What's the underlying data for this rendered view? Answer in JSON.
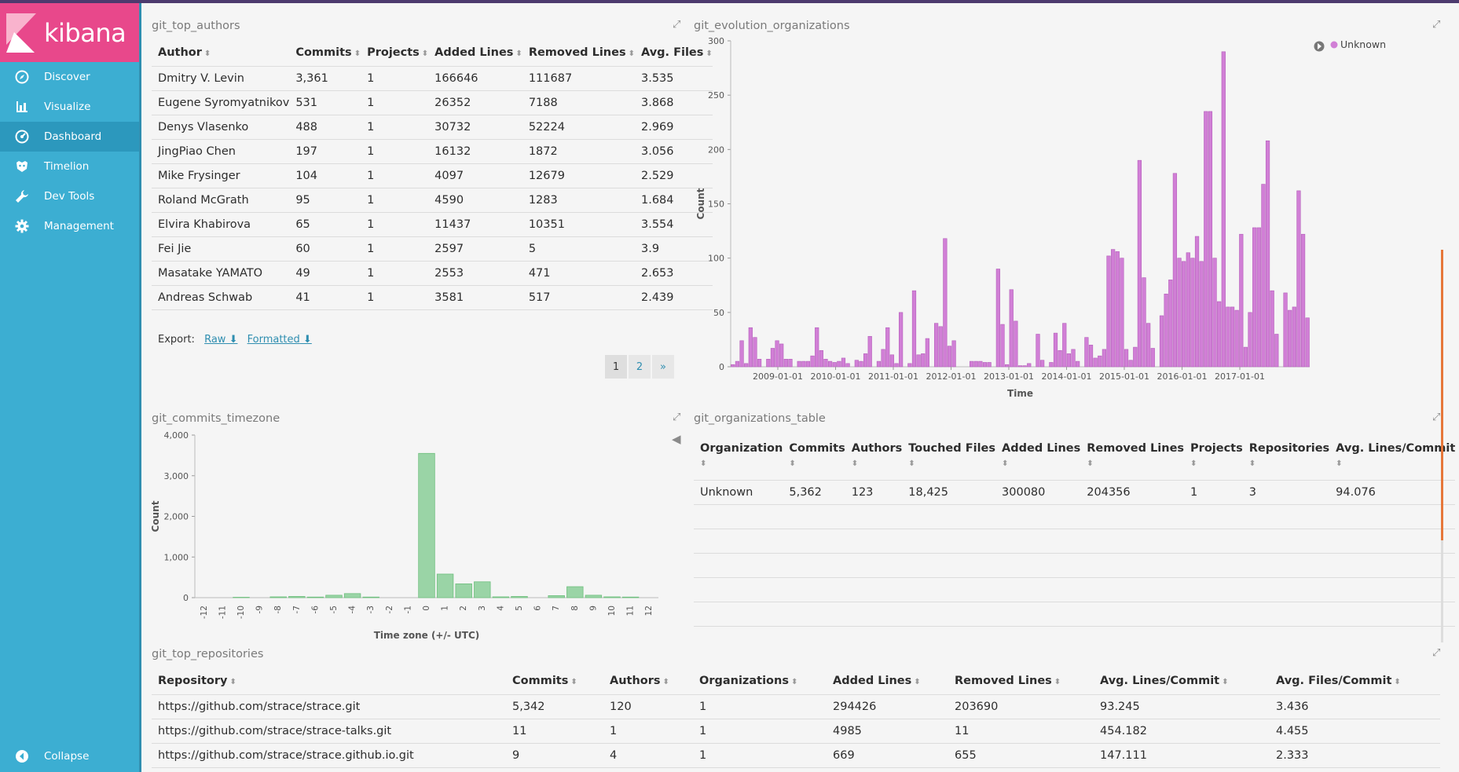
{
  "sidebar": {
    "brand": "kibana",
    "items": [
      {
        "label": "Discover",
        "icon": "compass-icon"
      },
      {
        "label": "Visualize",
        "icon": "bar-chart-icon"
      },
      {
        "label": "Dashboard",
        "icon": "dashboard-icon"
      },
      {
        "label": "Timelion",
        "icon": "timelion-icon"
      },
      {
        "label": "Dev Tools",
        "icon": "wrench-icon"
      },
      {
        "label": "Management",
        "icon": "gear-icon"
      }
    ],
    "active": "Dashboard",
    "collapse_label": "Collapse"
  },
  "top_authors": {
    "title": "git_top_authors",
    "headers": [
      "Author",
      "Commits",
      "Projects",
      "Added Lines",
      "Removed Lines",
      "Avg. Files"
    ],
    "rows": [
      [
        "Dmitry V. Levin",
        "3,361",
        "1",
        "166646",
        "111687",
        "3.535"
      ],
      [
        "Eugene Syromyatnikov",
        "531",
        "1",
        "26352",
        "7188",
        "3.868"
      ],
      [
        "Denys Vlasenko",
        "488",
        "1",
        "30732",
        "52224",
        "2.969"
      ],
      [
        "JingPiao Chen",
        "197",
        "1",
        "16132",
        "1872",
        "3.056"
      ],
      [
        "Mike Frysinger",
        "104",
        "1",
        "4097",
        "12679",
        "2.529"
      ],
      [
        "Roland McGrath",
        "95",
        "1",
        "4590",
        "1283",
        "1.684"
      ],
      [
        "Elvira Khabirova",
        "65",
        "1",
        "11437",
        "10351",
        "3.554"
      ],
      [
        "Fei Jie",
        "60",
        "1",
        "2597",
        "5",
        "3.9"
      ],
      [
        "Masatake YAMATO",
        "49",
        "1",
        "2553",
        "471",
        "2.653"
      ],
      [
        "Andreas Schwab",
        "41",
        "1",
        "3581",
        "517",
        "2.439"
      ]
    ],
    "export_label": "Export:",
    "export_raw": "Raw",
    "export_formatted": "Formatted",
    "pages": [
      "1",
      "2",
      "»"
    ]
  },
  "evolution": {
    "title": "git_evolution_organizations",
    "legend": "Unknown",
    "ylabel": "Count",
    "xlabel": "Time",
    "yticks": [
      "0",
      "50",
      "100",
      "150",
      "200",
      "250",
      "300"
    ],
    "xticks": [
      "2009-01-01",
      "2010-01-01",
      "2011-01-01",
      "2012-01-01",
      "2013-01-01",
      "2014-01-01",
      "2015-01-01",
      "2016-01-01",
      "2017-01-01"
    ],
    "color": "#d17fd6"
  },
  "timezone": {
    "title": "git_commits_timezone",
    "ylabel": "Count",
    "xlabel": "Time zone (+/- UTC)",
    "yticks": [
      "0",
      "1,000",
      "2,000",
      "3,000",
      "4,000"
    ],
    "color": "#9ad4a6"
  },
  "org_table": {
    "title": "git_organizations_table",
    "headers": [
      "Organization",
      "Commits",
      "Authors",
      "Touched Files",
      "Added Lines",
      "Removed Lines",
      "Projects",
      "Repositories",
      "Avg. Lines/Commit"
    ],
    "rows": [
      [
        "Unknown",
        "5,362",
        "123",
        "18,425",
        "300080",
        "204356",
        "1",
        "3",
        "94.076"
      ]
    ]
  },
  "top_repos": {
    "title": "git_top_repositories",
    "headers": [
      "Repository",
      "Commits",
      "Authors",
      "Organizations",
      "Added Lines",
      "Removed Lines",
      "Avg. Lines/Commit",
      "Avg. Files/Commit"
    ],
    "rows": [
      [
        "https://github.com/strace/strace.git",
        "5,342",
        "120",
        "1",
        "294426",
        "203690",
        "93.245",
        "3.436"
      ],
      [
        "https://github.com/strace/strace-talks.git",
        "11",
        "1",
        "1",
        "4985",
        "11",
        "454.182",
        "4.455"
      ],
      [
        "https://github.com/strace/strace.github.io.git",
        "9",
        "4",
        "1",
        "669",
        "655",
        "147.111",
        "2.333"
      ]
    ]
  },
  "chart_data": [
    {
      "type": "bar",
      "title": "git_evolution_organizations",
      "xlabel": "Time",
      "ylabel": "Count",
      "ylim": [
        0,
        300
      ],
      "series": [
        {
          "name": "Unknown",
          "values": [
            2,
            5,
            24,
            3,
            36,
            27,
            7,
            0,
            7,
            17,
            24,
            21,
            7,
            7,
            0,
            5,
            5,
            5,
            10,
            36,
            15,
            7,
            5,
            4,
            5,
            8,
            3,
            0,
            6,
            5,
            12,
            28,
            0,
            5,
            16,
            36,
            11,
            3,
            50,
            0,
            3,
            70,
            11,
            12,
            26,
            0,
            40,
            37,
            118,
            19,
            24,
            0,
            0,
            0,
            5,
            5,
            5,
            4,
            4,
            0,
            90,
            39,
            2,
            71,
            42,
            1,
            1,
            3,
            0,
            30,
            6,
            0,
            4,
            31,
            15,
            40,
            12,
            16,
            5,
            0,
            27,
            20,
            8,
            10,
            16,
            102,
            108,
            106,
            100,
            16,
            6,
            18,
            190,
            82,
            40,
            17,
            0,
            47,
            67,
            80,
            178,
            100,
            97,
            105,
            100,
            120,
            97,
            235,
            235,
            100,
            60,
            290,
            55,
            55,
            52,
            122,
            18,
            50,
            128,
            128,
            168,
            208,
            70,
            30,
            0,
            68,
            52,
            55,
            162,
            122,
            45
          ]
        }
      ]
    },
    {
      "type": "bar",
      "title": "git_commits_timezone",
      "xlabel": "Time zone (+/- UTC)",
      "ylabel": "Count",
      "ylim": [
        0,
        4000
      ],
      "categories": [
        "-12",
        "-11",
        "-10",
        "-9",
        "-8",
        "-7",
        "-6",
        "-5",
        "-4",
        "-3",
        "-2",
        "-1",
        "0",
        "1",
        "2",
        "3",
        "4",
        "5",
        "6",
        "7",
        "8",
        "9",
        "10",
        "11",
        "12"
      ],
      "values": [
        0,
        0,
        10,
        0,
        20,
        30,
        15,
        60,
        100,
        15,
        0,
        0,
        3550,
        580,
        340,
        390,
        20,
        30,
        0,
        50,
        270,
        60,
        20,
        15,
        0
      ]
    }
  ]
}
